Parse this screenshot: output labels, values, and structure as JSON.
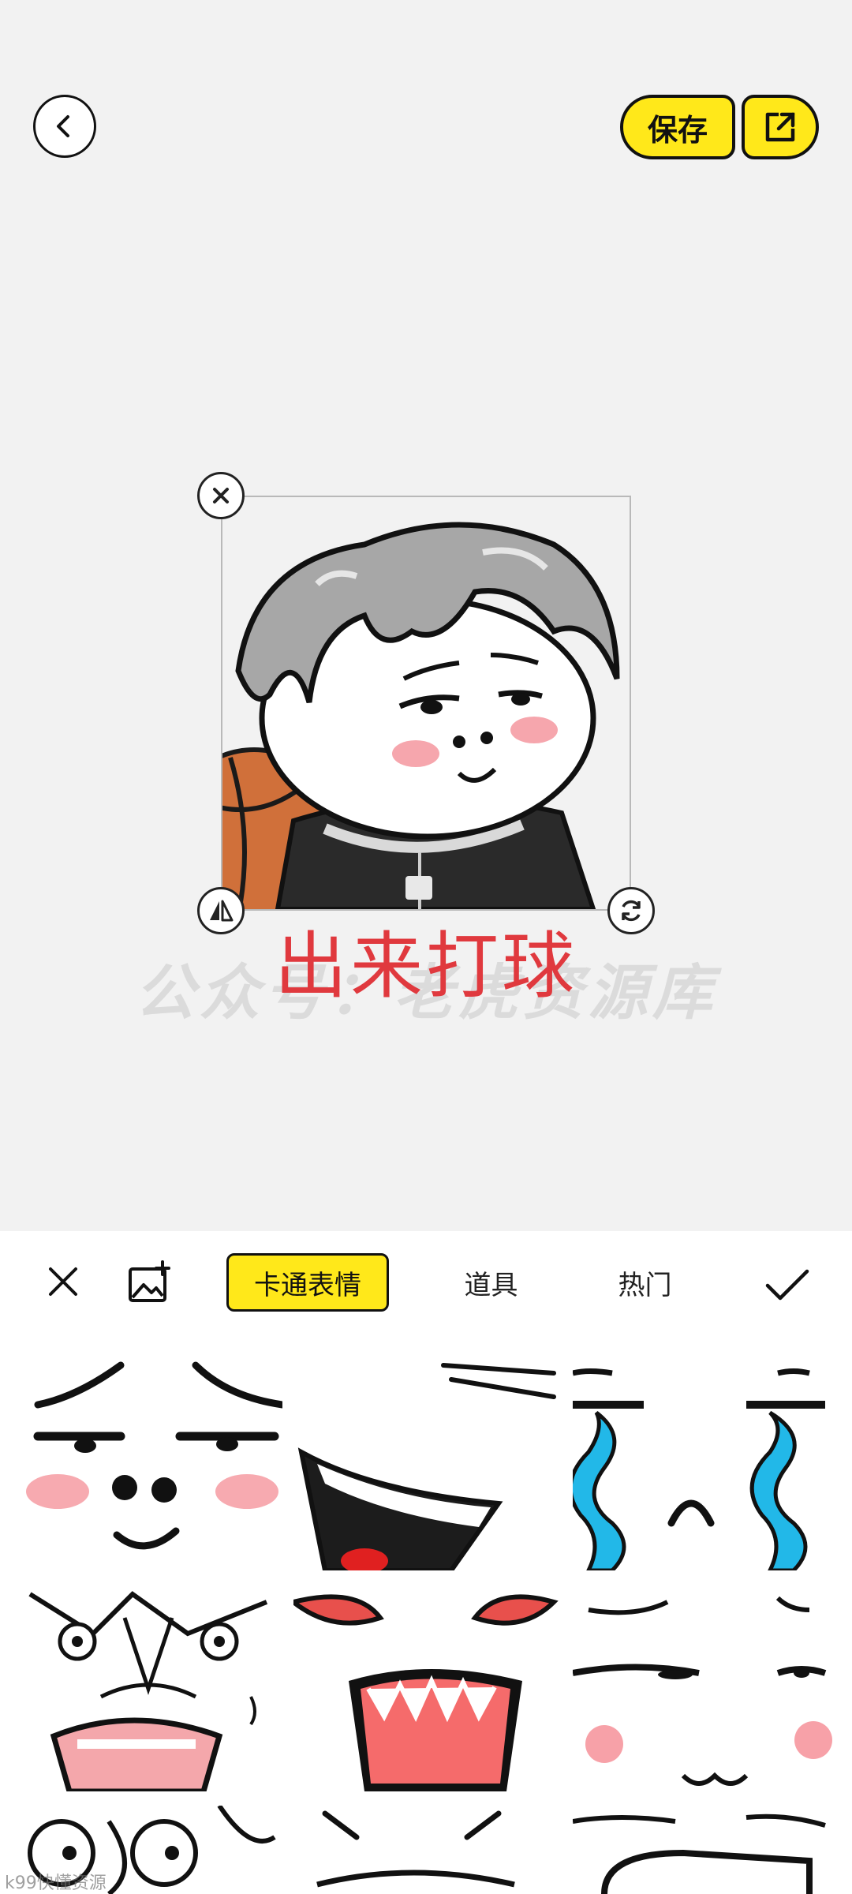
{
  "toolbar": {
    "save_label": "保存"
  },
  "canvas": {
    "caption": "出来打球",
    "watermark": "公众号：老虎资源库"
  },
  "tabs": {
    "active": "卡通表情",
    "tool": "道具",
    "hot": "热门"
  },
  "icons": {
    "back": "chevron-left-icon",
    "share": "external-link-icon",
    "close": "close-icon",
    "add_image": "image-add-icon",
    "confirm": "check-icon",
    "flip": "flip-icon",
    "rotate": "rotate-icon"
  },
  "colors": {
    "accent": "#ffe81a",
    "caption": "#e0393e",
    "background": "#f2f2f2"
  },
  "footer": {
    "watermark": "k99快懂资源"
  }
}
